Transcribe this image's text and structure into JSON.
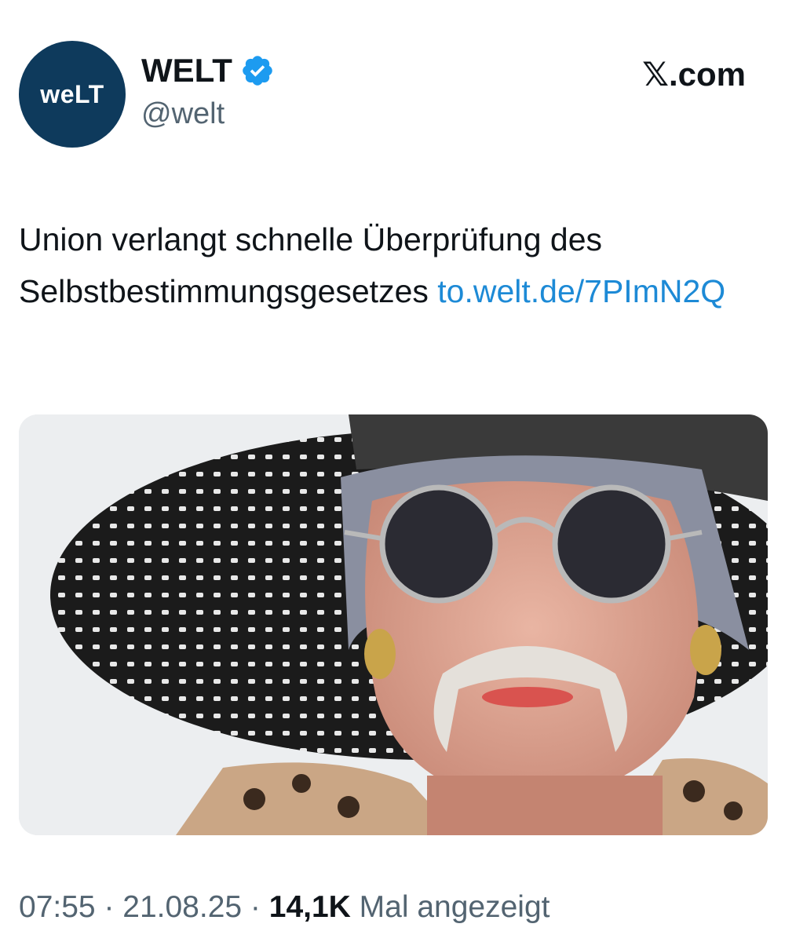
{
  "account": {
    "avatar_text": "weLT",
    "display_name": "WELT",
    "handle": "@welt",
    "verified_icon": "verified-badge-icon",
    "verified_color": "#1d9bf0"
  },
  "site_label": "𝕏.com",
  "tweet": {
    "text": "Union verlangt schnelle Überprüfung des Selbstbestimmungsgesetzes ",
    "link": "to.welt.de/7PImN2Q"
  },
  "media": {
    "description_icon": "photo"
  },
  "meta": {
    "time": "07:55",
    "sep1": " · ",
    "date": "21.08.25",
    "sep2": " · ",
    "views": "14,1K",
    "views_suffix": " Mal angezeigt"
  },
  "colors": {
    "brand_navy": "#0e3a5c",
    "link": "#1d8ad6",
    "secondary_text": "#536471"
  }
}
